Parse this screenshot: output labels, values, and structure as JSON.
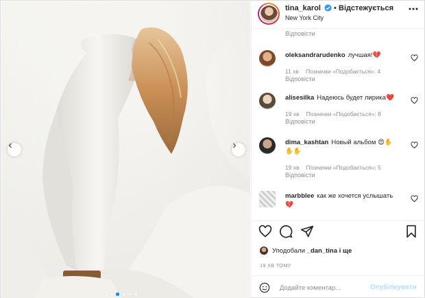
{
  "post": {
    "username": "tina_karol",
    "separator": "•",
    "follow_label": "Відстежується",
    "location": "New York City",
    "verified_icon": "verified-badge-icon",
    "more_icon": "more-options-icon",
    "carousel": {
      "slides": 5,
      "active_slide": 1
    }
  },
  "comments": {
    "top_reply_label": "Відповісти",
    "items": [
      {
        "user": "oleksandrarudenko",
        "text": "лучшая!",
        "emoji": "💔",
        "time": "11 хв",
        "likes": "Позначки «Подобається»: 4",
        "reply": "Відповісти"
      },
      {
        "user": "alisesilka",
        "text": "Надеюсь будет лирика",
        "emoji": "❤️",
        "time": "19 хв",
        "likes": "Позначки «Подобається»: 8",
        "reply": "Відповісти"
      },
      {
        "user": "dima_kashtan",
        "text": "Новый альбом",
        "emoji": "😍✋✋✋",
        "time": "19 хв",
        "likes": "Позначки «Подобається»: 5",
        "reply": "Відповісти"
      },
      {
        "user": "marbblee",
        "text": "как же хочется услышать",
        "emoji": "💔",
        "time": "",
        "likes": "",
        "reply": ""
      }
    ]
  },
  "actions": {
    "like_icon": "heart-icon",
    "comment_icon": "comment-bubble-icon",
    "share_icon": "paper-plane-icon",
    "save_icon": "bookmark-icon"
  },
  "liked_by": {
    "prefix": "Уподобали",
    "user": "_dan_tina",
    "suffix": "і ще"
  },
  "timestamp": "19 ХВ ТОМУ",
  "add_comment": {
    "placeholder": "Додайте коментар...",
    "publish_label": "Опублікувати",
    "emoji_icon": "smiley-icon"
  },
  "colors": {
    "link_blue": "#0095f6",
    "publish_disabled": "#b2dffc",
    "secondary_text": "#8e8e8e",
    "primary_text": "#262626",
    "heart_red": "#ed4956"
  }
}
